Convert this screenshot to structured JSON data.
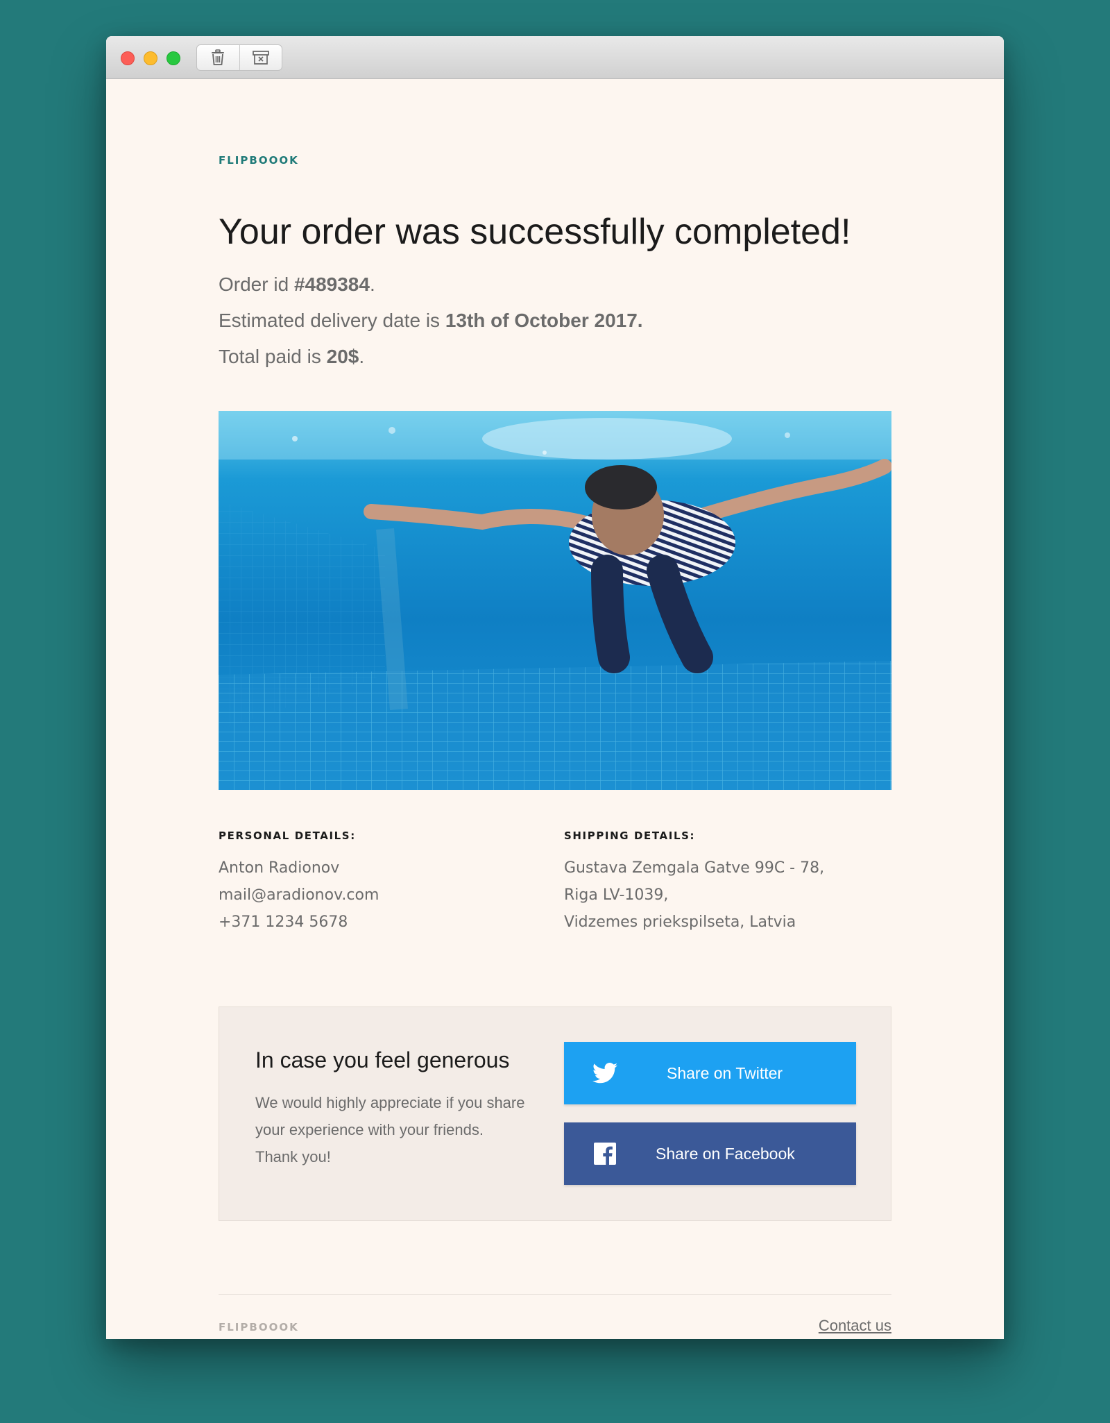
{
  "toolbar": {
    "icons": [
      "trash-icon",
      "archive-delete-icon"
    ]
  },
  "brand": "FLIPBOOOK",
  "headline": "Your order was successfully completed!",
  "order": {
    "id_prefix": "Order id ",
    "id": "#489384",
    "id_suffix": ".",
    "delivery_prefix": "Estimated delivery date is ",
    "delivery_date": "13th of October 2017.",
    "total_prefix": "Total paid is ",
    "total": "20$",
    "total_suffix": "."
  },
  "personal": {
    "title": "PERSONAL DETAILS:",
    "lines": [
      "Anton Radionov",
      "mail@aradionov.com",
      "+371 1234 5678"
    ]
  },
  "shipping": {
    "title": "SHIPPING DETAILS:",
    "lines": [
      "Gustava Zemgala Gatve 99C - 78,",
      "Riga LV-1039,",
      "Vidzemes priekspilseta, Latvia"
    ]
  },
  "generous": {
    "title": "In case you feel generous",
    "lines": [
      "We would highly appreciate if you share",
      "your experience with your friends.",
      "Thank you!"
    ],
    "twitter_label": "Share on Twitter",
    "facebook_label": "Share on Facebook"
  },
  "colors": {
    "accent": "#1f7a78",
    "twitter": "#1da1f2",
    "facebook": "#3b5998",
    "background": "#237a7a"
  },
  "footer": {
    "brand": "FLIPBOOOK",
    "contact": "Contact us"
  }
}
